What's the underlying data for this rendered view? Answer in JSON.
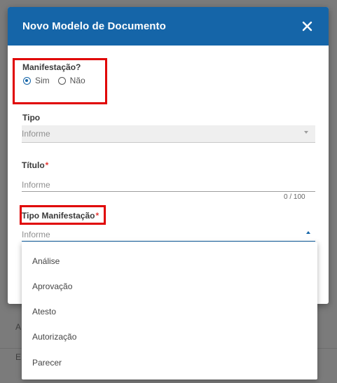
{
  "background": {
    "letters": [
      "A",
      "E"
    ]
  },
  "dialog": {
    "title": "Novo Modelo de Documento",
    "close_icon": "close-icon"
  },
  "form": {
    "manifestacao": {
      "label": "Manifestação?",
      "options": [
        "Sim",
        "Não"
      ],
      "selected": "Sim"
    },
    "tipo": {
      "label": "Tipo",
      "placeholder": "Informe"
    },
    "titulo": {
      "label": "Título",
      "required_mark": "*",
      "placeholder": "Informe",
      "counter": "0 / 100"
    },
    "tipo_manifestacao": {
      "label": "Tipo Manifestação",
      "required_mark": "*",
      "placeholder": "Informe",
      "options": [
        "Análise",
        "Aprovação",
        "Atesto",
        "Autorização",
        "Parecer"
      ]
    }
  },
  "colors": {
    "header": "#1565a8",
    "highlight": "#e00000",
    "required": "#e53935"
  }
}
